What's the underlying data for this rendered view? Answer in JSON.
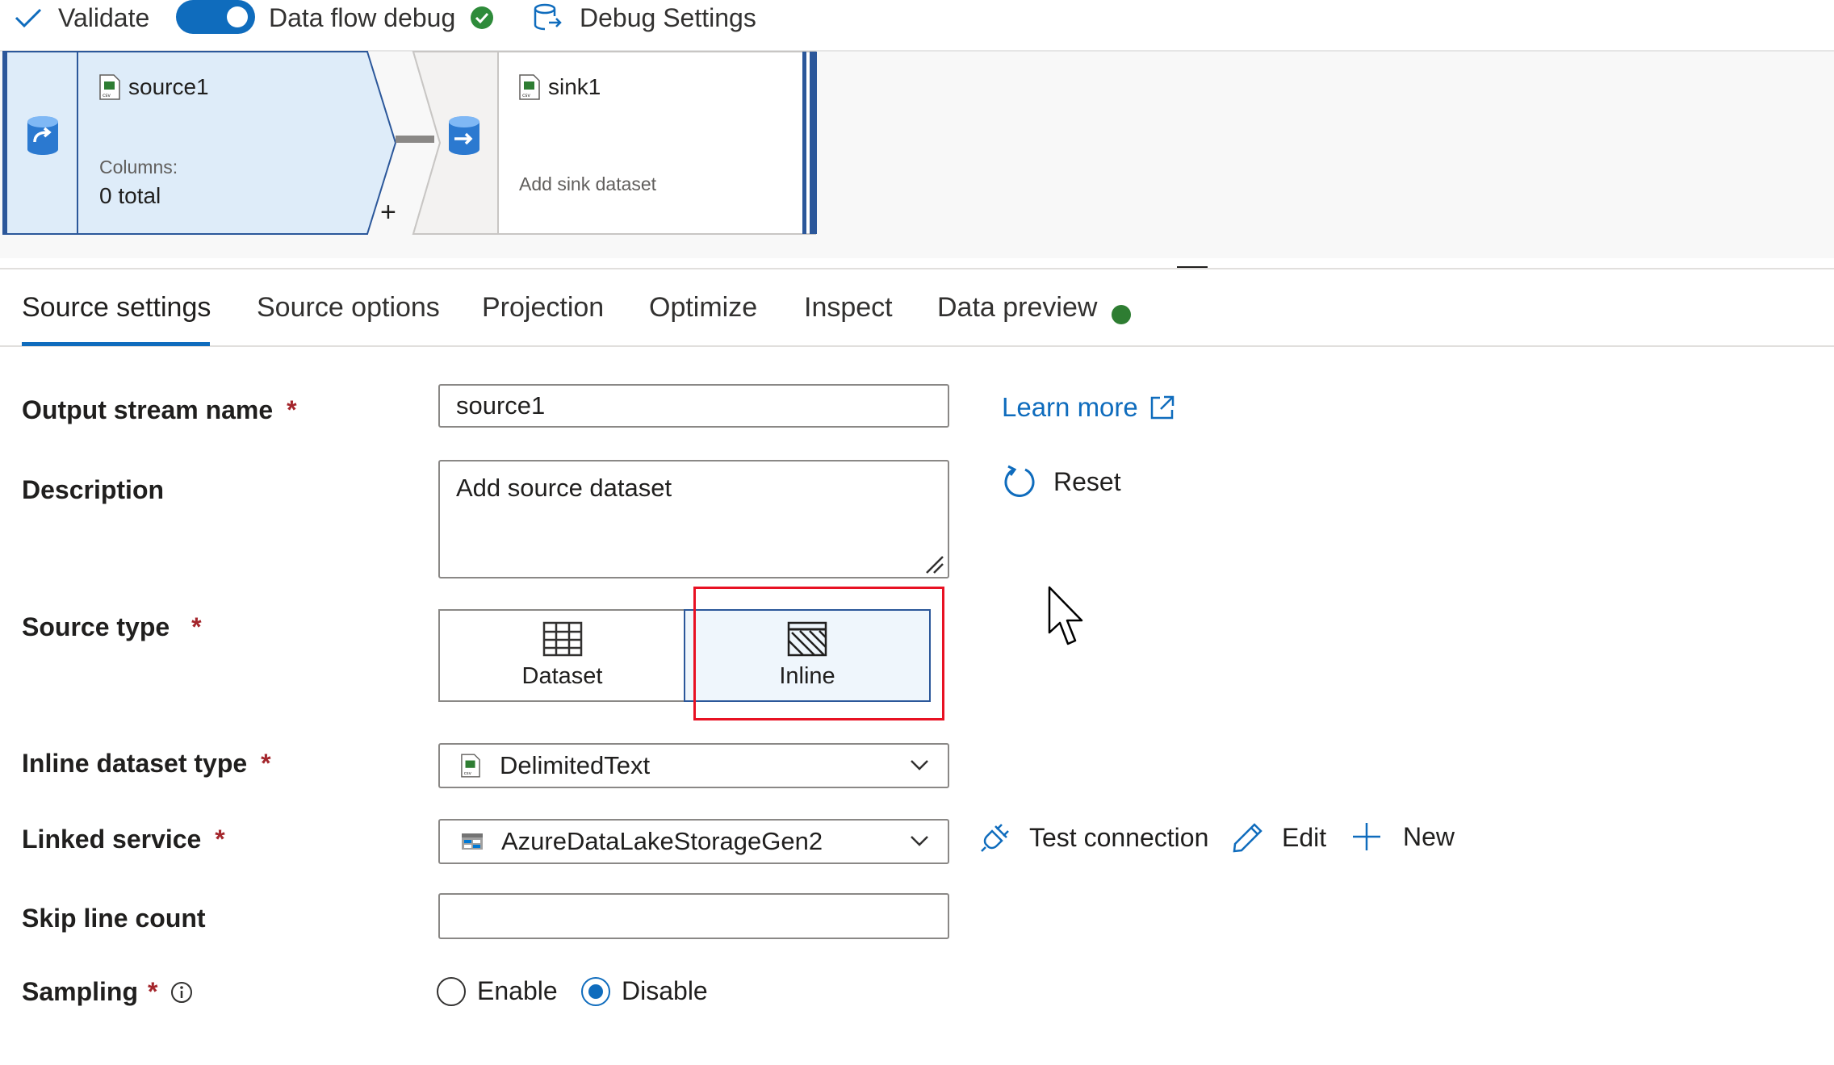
{
  "toolbar": {
    "validate_label": "Validate",
    "debug_label": "Data flow debug",
    "debug_enabled": true,
    "debug_settings_label": "Debug Settings"
  },
  "canvas": {
    "source_node": {
      "name": "source1",
      "columns_label": "Columns:",
      "columns_value": "0 total",
      "add_symbol": "+"
    },
    "sink_node": {
      "name": "sink1",
      "subtitle": "Add sink dataset"
    }
  },
  "tabs": [
    {
      "label": "Source settings",
      "active": true
    },
    {
      "label": "Source options",
      "active": false
    },
    {
      "label": "Projection",
      "active": false
    },
    {
      "label": "Optimize",
      "active": false
    },
    {
      "label": "Inspect",
      "active": false
    },
    {
      "label": "Data preview",
      "active": false,
      "status_color": "#2e7d32"
    }
  ],
  "form": {
    "required_marker": "*",
    "output_stream": {
      "label": "Output stream name",
      "value": "source1"
    },
    "learn_more_label": "Learn more",
    "description": {
      "label": "Description",
      "value": "Add source dataset"
    },
    "reset_label": "Reset",
    "source_type": {
      "label": "Source type",
      "options": [
        "Dataset",
        "Inline"
      ],
      "selected": "Inline"
    },
    "inline_dataset_type": {
      "label": "Inline dataset type",
      "value": "DelimitedText"
    },
    "linked_service": {
      "label": "Linked service",
      "value": "AzureDataLakeStorageGen2"
    },
    "linked_actions": {
      "test_connection": "Test connection",
      "edit": "Edit",
      "new": "New"
    },
    "skip_line_count": {
      "label": "Skip line count",
      "value": ""
    },
    "sampling": {
      "label": "Sampling",
      "options": [
        "Enable",
        "Disable"
      ],
      "selected": "Disable"
    }
  },
  "colors": {
    "accent": "#0f6cbd",
    "highlight_box": "#e81123",
    "success": "#2e7d32",
    "node_fill": "#deecf9"
  }
}
